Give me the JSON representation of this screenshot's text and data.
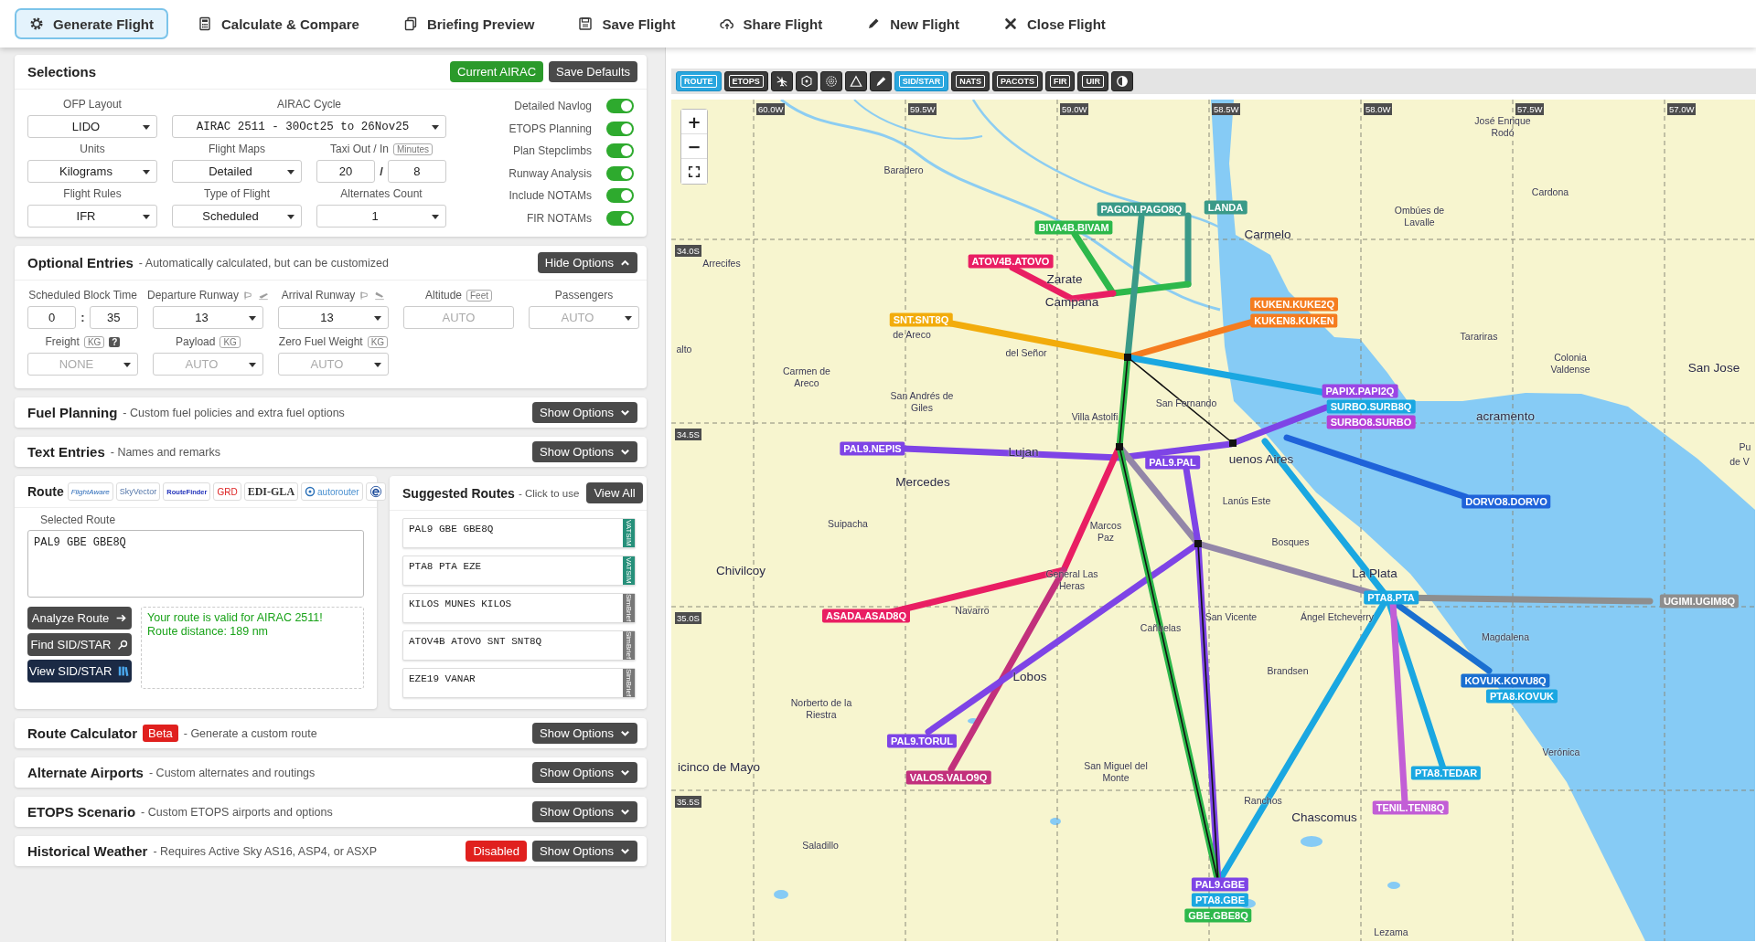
{
  "nav": [
    {
      "label": "Generate Flight",
      "selected": true
    },
    {
      "label": "Calculate & Compare",
      "selected": false
    },
    {
      "label": "Briefing Preview",
      "selected": false
    },
    {
      "label": "Save Flight",
      "selected": false
    },
    {
      "label": "Share Flight",
      "selected": false
    },
    {
      "label": "New Flight",
      "selected": false
    },
    {
      "label": "Close Flight",
      "selected": false
    }
  ],
  "selections": {
    "title": "Selections",
    "buttons": [
      {
        "label": "Current AIRAC",
        "kind": "success"
      },
      {
        "label": "Save Defaults",
        "kind": "dark"
      }
    ],
    "fields": [
      {
        "label": "OFP Layout",
        "kind": "select",
        "value": "LIDO"
      },
      {
        "label": "AIRAC Cycle",
        "kind": "wide_select",
        "value": "AIRAC 2511 - 30Oct25 to 26Nov25"
      },
      {
        "label": "Units",
        "kind": "select",
        "value": "Kilograms"
      },
      {
        "label": "Flight Maps",
        "kind": "select",
        "value": "Detailed"
      },
      {
        "label": "Taxi Out / In",
        "unit": "Minutes",
        "kind": "pair",
        "values": [
          "20",
          "8"
        ],
        "separator": "/"
      },
      {
        "label": "Flight Rules",
        "kind": "select",
        "value": "IFR"
      },
      {
        "label": "Type of Flight",
        "kind": "select",
        "value": "Scheduled"
      },
      {
        "label": "Alternates Count",
        "kind": "select",
        "value": "1"
      }
    ],
    "toggles": [
      {
        "label": "Detailed Navlog",
        "on": true
      },
      {
        "label": "ETOPS Planning",
        "on": true
      },
      {
        "label": "Plan Stepclimbs",
        "on": true
      },
      {
        "label": "Runway Analysis",
        "on": true
      },
      {
        "label": "Include NOTAMs",
        "on": true
      },
      {
        "label": "FIR NOTAMs",
        "on": true
      }
    ]
  },
  "optional": {
    "title": "Optional Entries",
    "subtitle": "- Automatically calculated, but can be customized",
    "button": "Hide Options",
    "expanded": true,
    "fields": [
      {
        "label": "Scheduled Block Time",
        "kind": "pair",
        "values": [
          "0",
          "35"
        ],
        "separator": ":"
      },
      {
        "label": "Departure Runway",
        "kind": "departure_runway",
        "value": "13"
      },
      {
        "label": "Arrival Runway",
        "kind": "arrival_runway",
        "value": "13"
      },
      {
        "label": "Altitude",
        "unit": "Feet",
        "kind": "input",
        "placeholder": "AUTO"
      },
      {
        "label": "Passengers",
        "kind": "select",
        "placeholder": "AUTO"
      },
      {
        "label": "Freight",
        "unit": "KG",
        "help": "?",
        "kind": "select",
        "placeholder": "NONE"
      },
      {
        "label": "Payload",
        "unit": "KG",
        "kind": "select",
        "placeholder": "AUTO"
      },
      {
        "label": "Zero Fuel Weight",
        "unit": "KG",
        "kind": "select",
        "placeholder": "AUTO"
      }
    ]
  },
  "sections_upper": [
    {
      "title": "Fuel Planning",
      "subtitle": "- Custom fuel policies and extra fuel options",
      "button": "Show Options",
      "expanded": false
    },
    {
      "title": "Text Entries",
      "subtitle": "- Names and remarks",
      "button": "Show Options",
      "expanded": false
    }
  ],
  "route": {
    "title": "Route",
    "sources": [
      {
        "kind": "flightaware",
        "label": "FlightAware"
      },
      {
        "kind": "skyvector",
        "label": "SkyVector"
      },
      {
        "kind": "routefinder",
        "label": "RouteFinder"
      },
      {
        "kind": "grd",
        "label": "GRD"
      },
      {
        "kind": "edigla",
        "label": "EDI-GLA"
      },
      {
        "kind": "autorouter",
        "label": "autorouter"
      },
      {
        "kind": "icon"
      }
    ],
    "field_label": "Selected Route",
    "value": "PAL9 GBE GBE8Q",
    "buttons": [
      {
        "label": "Analyze Route",
        "kind": "dark"
      },
      {
        "label": "Find SID/STAR",
        "kind": "dark"
      },
      {
        "label": "View SID/STAR",
        "kind": "navy"
      }
    ],
    "message": [
      "Your route is valid for AIRAC 2511!",
      "Route distance: 189 nm"
    ]
  },
  "suggested": {
    "title": "Suggested Routes",
    "subtitle": "- Click to use",
    "button": "View All",
    "routes": [
      {
        "route": "PAL9 GBE GBE8Q",
        "source": "VATSIM",
        "kind": "vatsim"
      },
      {
        "route": "PTA8 PTA EZE",
        "source": "VATSIM",
        "kind": "vatsim"
      },
      {
        "route": "KILOS MUNES KILOS",
        "source": "SimBrief",
        "kind": "simbrief"
      },
      {
        "route": "ATOV4B ATOVO SNT SNT8Q",
        "source": "SimBrief",
        "kind": "simbrief"
      },
      {
        "route": "EZE19 VANAR",
        "source": "SimBrief",
        "kind": "simbrief"
      }
    ]
  },
  "sections_lower": [
    {
      "title": "Route Calculator",
      "badge": {
        "label": "Beta",
        "kind": "inline"
      },
      "subtitle": "- Generate a custom route",
      "button": "Show Options",
      "expanded": false
    },
    {
      "title": "Alternate Airports",
      "subtitle": "- Custom alternates and routings",
      "button": "Show Options",
      "expanded": false
    },
    {
      "title": "ETOPS Scenario",
      "subtitle": "- Custom ETOPS airports and options",
      "button": "Show Options",
      "expanded": false
    },
    {
      "title": "Historical Weather",
      "subtitle": "- Requires Active Sky AS16, ASP4, or ASXP",
      "badge": {
        "label": "Disabled",
        "kind": "action"
      },
      "button": "Show Options",
      "expanded": false
    }
  ],
  "map": {
    "toolbar": [
      {
        "kind": "text",
        "label": "ROUTE",
        "selected": true
      },
      {
        "kind": "text",
        "label": "ETOPS",
        "selected": false
      },
      {
        "kind": "icon",
        "selected": false
      },
      {
        "kind": "icon",
        "selected": false
      },
      {
        "kind": "icon",
        "selected": false
      },
      {
        "kind": "icon",
        "selected": false
      },
      {
        "kind": "icon",
        "selected": false
      },
      {
        "kind": "text",
        "label": "SID/STAR",
        "selected": true
      },
      {
        "kind": "text",
        "label": "NATS",
        "selected": false
      },
      {
        "kind": "text",
        "label": "PACOTS",
        "selected": false
      },
      {
        "kind": "text",
        "label": "FIR",
        "selected": false
      },
      {
        "kind": "text",
        "label": "UIR",
        "selected": false
      },
      {
        "kind": "icon",
        "selected": false
      }
    ],
    "zoom": [
      "+",
      "−"
    ],
    "lon_labels": [
      "60.0W",
      "59.5W",
      "59.0W",
      "58.5W",
      "58.0W",
      "57.5W",
      "57.0W"
    ],
    "lat_labels": [
      "34.0S",
      "34.5S",
      "35.0S",
      "35.5S"
    ],
    "places": [
      {
        "name": "Baradero",
        "kind": "town"
      },
      {
        "name": "José Enrique Rodó",
        "kind": "town"
      },
      {
        "name": "Cardona",
        "kind": "town"
      },
      {
        "name": "Ombúes de Lavalle",
        "kind": "town"
      },
      {
        "name": "Carmelo",
        "kind": "city"
      },
      {
        "name": "Arrecifes",
        "kind": "town"
      },
      {
        "name": "Zarate",
        "kind": "city"
      },
      {
        "name": "Campana",
        "kind": "city"
      },
      {
        "name": "de Areco",
        "kind": "town"
      },
      {
        "name": "del Señor",
        "kind": "town"
      },
      {
        "name": "Tarariras",
        "kind": "town"
      },
      {
        "name": "Colonia Valdense",
        "kind": "town"
      },
      {
        "name": "San Jose",
        "kind": "city"
      },
      {
        "name": "alto",
        "kind": "town"
      },
      {
        "name": "Carmen de Areco",
        "kind": "town"
      },
      {
        "name": "San Andrés de Giles",
        "kind": "town"
      },
      {
        "name": "San Fernando",
        "kind": "town"
      },
      {
        "name": "Villa Astolfi",
        "kind": "town"
      },
      {
        "name": "acramento",
        "kind": "city"
      },
      {
        "name": "Pu",
        "kind": "town"
      },
      {
        "name": "de V",
        "kind": "town"
      },
      {
        "name": "Lujan",
        "kind": "city"
      },
      {
        "name": "uenos Aires",
        "kind": "city"
      },
      {
        "name": "Mercedes",
        "kind": "city"
      },
      {
        "name": "Lanús Este",
        "kind": "town"
      },
      {
        "name": "Suipacha",
        "kind": "town"
      },
      {
        "name": "Marcos Paz",
        "kind": "town"
      },
      {
        "name": "Bosques",
        "kind": "town"
      },
      {
        "name": "Chivilcoy",
        "kind": "city"
      },
      {
        "name": "General Las Heras",
        "kind": "town"
      },
      {
        "name": "La Plata",
        "kind": "city"
      },
      {
        "name": "Navarro",
        "kind": "town"
      },
      {
        "name": "San Vicente",
        "kind": "town"
      },
      {
        "name": "Ángel Etcheverry",
        "kind": "town"
      },
      {
        "name": "Cañuelas",
        "kind": "town"
      },
      {
        "name": "Magdalena",
        "kind": "town"
      },
      {
        "name": "Lobos",
        "kind": "city"
      },
      {
        "name": "Brandsen",
        "kind": "town"
      },
      {
        "name": "Norberto de la Riestra",
        "kind": "town"
      },
      {
        "name": "icinco de Mayo",
        "kind": "city"
      },
      {
        "name": "San Miguel del Monte",
        "kind": "town"
      },
      {
        "name": "Verónica",
        "kind": "town"
      },
      {
        "name": "Ranchos",
        "kind": "town"
      },
      {
        "name": "Chascomus",
        "kind": "city"
      },
      {
        "name": "Saladillo",
        "kind": "town"
      },
      {
        "name": "Lezama",
        "kind": "town"
      }
    ],
    "route_labels": [
      {
        "label": "PAGON.PAGO8Q",
        "color": "#3a9a88"
      },
      {
        "label": "LANDA",
        "color": "#3a9a88"
      },
      {
        "label": "BIVA4B.BIVAM",
        "color": "#2db84b"
      },
      {
        "label": "ATOV4B.ATOVO",
        "color": "#e91e63"
      },
      {
        "label": "SNT.SNT8Q",
        "color": "#f2ac0c"
      },
      {
        "label": "KUKEN.KUKE2Q",
        "color": "#f57c1f"
      },
      {
        "label": "KUKEN8.KUKEN",
        "color": "#f57c1f"
      },
      {
        "label": "PAPIX.PAPI2Q",
        "color": "#9b45e4"
      },
      {
        "label": "SURBO.SURB8Q",
        "color": "#1aa7e1"
      },
      {
        "label": "SURBO8.SURBO",
        "color": "#b43fd8"
      },
      {
        "label": "PAL9.NEPIS",
        "color": "#7e44e6"
      },
      {
        "label": "PAL9.PAL",
        "color": "#7e44e6"
      },
      {
        "label": "DORVO8.DORVO",
        "color": "#1f63d9"
      },
      {
        "label": "ASADA.ASAD8Q",
        "color": "#e91e63"
      },
      {
        "label": "PTA8.PTA",
        "color": "#1aa7e1"
      },
      {
        "label": "UGIMI.UGIM8Q",
        "color": "#8e8e8e"
      },
      {
        "label": "KOVUK.KOVU8Q",
        "color": "#1a6fd0"
      },
      {
        "label": "PTA8.KOVUK",
        "color": "#1aa7e1"
      },
      {
        "label": "PAL9.TORUL",
        "color": "#7e44e6"
      },
      {
        "label": "VALOS.VALO9Q",
        "color": "#c2307c"
      },
      {
        "label": "PTA8.TEDAR",
        "color": "#1aa7e1"
      },
      {
        "label": "TENIL.TENI8Q",
        "color": "#c25ed6"
      },
      {
        "label": "PAL9.GBE",
        "color": "#7e44e6"
      },
      {
        "label": "PTA8.GBE",
        "color": "#1aa7e1"
      },
      {
        "label": "GBE.GBE8Q",
        "color": "#2db84b"
      }
    ]
  }
}
